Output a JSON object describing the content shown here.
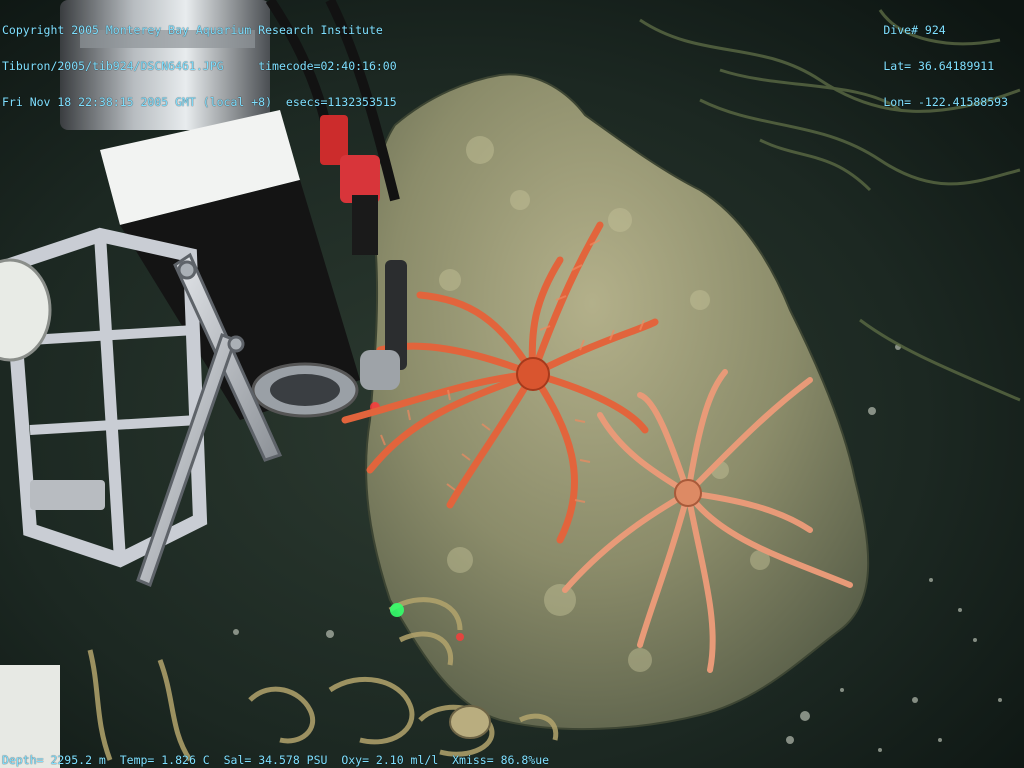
{
  "overlay": {
    "top_left": {
      "line1": "Copyright 2005 Monterey Bay Aquarium Research Institute",
      "line2_file": "Tiburon/2005/tib924/DSCN6461.JPG",
      "line2_timecode": "timecode=02:40:16:00",
      "line3_datetime": "Fri Nov 18 22:38:15 2005 GMT (local +8)",
      "line3_esecs": "esecs=1132353515"
    },
    "top_right": {
      "dive": "Dive# 924",
      "lat": "Lat= 36.64189911",
      "lon": "Lon= -122.41588593"
    },
    "bottom": {
      "depth": "Depth= 2295.2 m",
      "temp": "Temp= 1.826 C",
      "sal": "Sal= 34.578 PSU",
      "oxy": "Oxy= 2.10 ml/l",
      "xmiss": "Xmiss= 86.8%ue"
    }
  },
  "colors": {
    "overlay_text": "#7fe0ff",
    "seafloor": "#1d2a24",
    "rock": "#8c8f6e",
    "sea_star_main": "#e2643c",
    "sea_star_pale": "#e89a78",
    "bracket_metal": "#c9cdd4"
  },
  "scene_elements": [
    "rov-camera-housing",
    "aluminum-bracket",
    "rock-outcrop",
    "brisingid-sea-star-orange",
    "brisingid-sea-star-pale",
    "coiled-debris",
    "laser-dots"
  ]
}
